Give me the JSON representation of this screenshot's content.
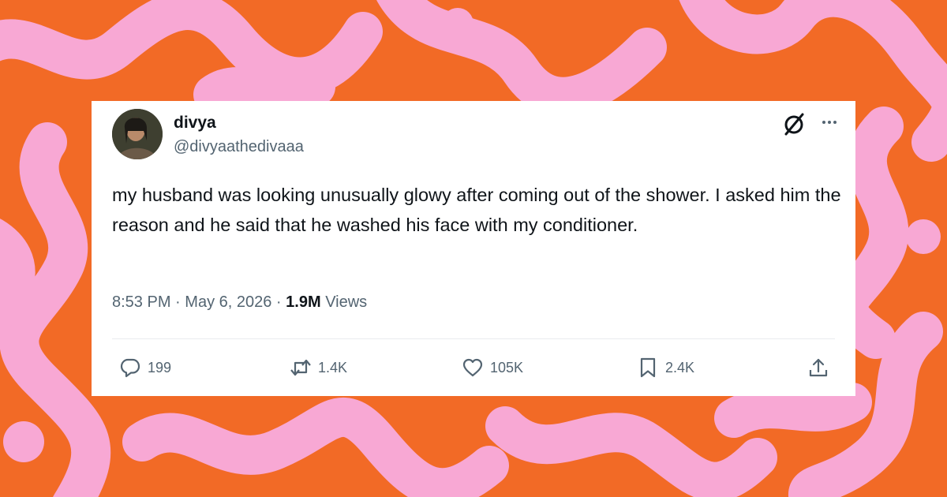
{
  "colors": {
    "background_orange": "#f26a26",
    "background_pink": "#f8a8d4",
    "card": "#ffffff",
    "text_primary": "#0f1419",
    "text_secondary": "#536471"
  },
  "tweet": {
    "display_name": "divya",
    "handle": "@divyaathedivaaa",
    "text": "my husband was looking unusually glowy after coming out of the shower. I asked him the reason and he said that he washed his face with my conditioner.",
    "time": "8:53 PM",
    "date": "May 6, 2026",
    "separator": "·",
    "views_count": "1.9M",
    "views_label": "Views",
    "actions": {
      "replies": "199",
      "reposts": "1.4K",
      "likes": "105K",
      "bookmarks": "2.4K"
    }
  },
  "icons": [
    "x-logo-icon",
    "more-dots-icon",
    "reply-icon",
    "repost-icon",
    "like-icon",
    "bookmark-icon",
    "share-icon"
  ]
}
